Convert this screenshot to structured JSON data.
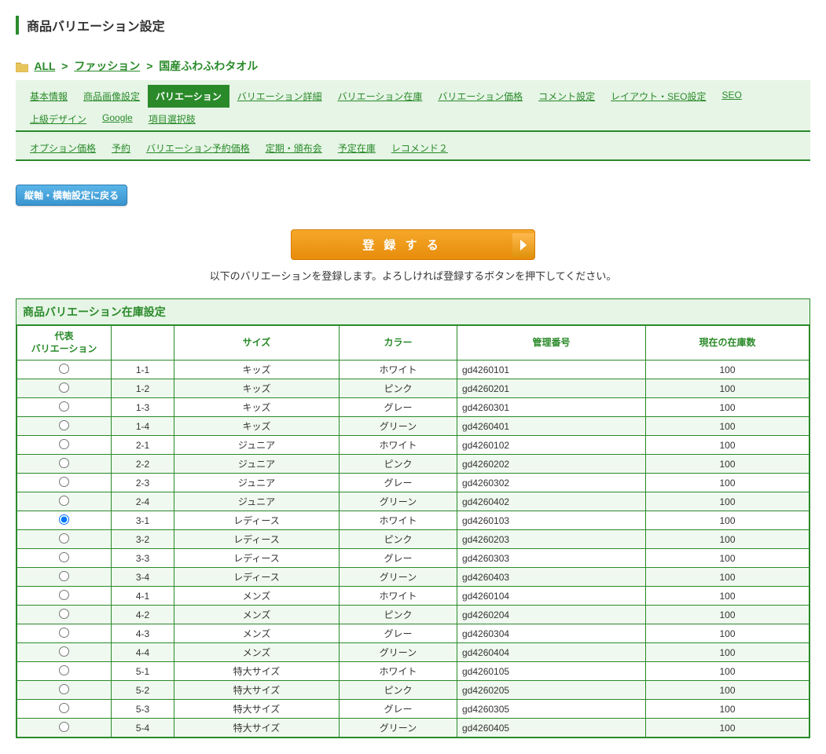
{
  "page_title": "商品バリエーション設定",
  "breadcrumb": {
    "all": "ALL",
    "category": "ファッション",
    "product": "国産ふわふわタオル"
  },
  "tabs": {
    "row1": [
      {
        "label": "基本情報",
        "active": false
      },
      {
        "label": "商品画像設定",
        "active": false
      },
      {
        "label": "バリエーション",
        "active": true
      },
      {
        "label": "バリエーション詳細",
        "active": false
      },
      {
        "label": "バリエーション在庫",
        "active": false
      },
      {
        "label": "バリエーション価格",
        "active": false
      },
      {
        "label": "コメント設定",
        "active": false
      },
      {
        "label": "レイアウト・SEO設定",
        "active": false
      },
      {
        "label": "SEO",
        "active": false
      },
      {
        "label": "上級デザイン",
        "active": false
      },
      {
        "label": "Google",
        "active": false
      },
      {
        "label": "項目選択肢",
        "active": false
      }
    ],
    "row2": [
      {
        "label": "オプション価格",
        "active": false
      },
      {
        "label": "予約",
        "active": false
      },
      {
        "label": "バリエーション予約価格",
        "active": false
      },
      {
        "label": "定期・頒布会",
        "active": false
      },
      {
        "label": "予定在庫",
        "active": false
      },
      {
        "label": "レコメンド２",
        "active": false
      }
    ]
  },
  "back_button": "縦軸・横軸設定に戻る",
  "register_button": "登 録 す る",
  "register_note": "以下のバリエーションを登録します。よろしければ登録するボタンを押下してください。",
  "panel_title": "商品バリエーション在庫設定",
  "columns": {
    "rep": "代表\nバリエーション",
    "idx": "",
    "size": "サイズ",
    "color": "カラー",
    "code": "管理番号",
    "stock": "現在の在庫数"
  },
  "rows": [
    {
      "selected": false,
      "idx": "1-1",
      "size": "キッズ",
      "color": "ホワイト",
      "code": "gd4260101",
      "stock": "100"
    },
    {
      "selected": false,
      "idx": "1-2",
      "size": "キッズ",
      "color": "ピンク",
      "code": "gd4260201",
      "stock": "100"
    },
    {
      "selected": false,
      "idx": "1-3",
      "size": "キッズ",
      "color": "グレー",
      "code": "gd4260301",
      "stock": "100"
    },
    {
      "selected": false,
      "idx": "1-4",
      "size": "キッズ",
      "color": "グリーン",
      "code": "gd4260401",
      "stock": "100"
    },
    {
      "selected": false,
      "idx": "2-1",
      "size": "ジュニア",
      "color": "ホワイト",
      "code": "gd4260102",
      "stock": "100"
    },
    {
      "selected": false,
      "idx": "2-2",
      "size": "ジュニア",
      "color": "ピンク",
      "code": "gd4260202",
      "stock": "100"
    },
    {
      "selected": false,
      "idx": "2-3",
      "size": "ジュニア",
      "color": "グレー",
      "code": "gd4260302",
      "stock": "100"
    },
    {
      "selected": false,
      "idx": "2-4",
      "size": "ジュニア",
      "color": "グリーン",
      "code": "gd4260402",
      "stock": "100"
    },
    {
      "selected": true,
      "idx": "3-1",
      "size": "レディース",
      "color": "ホワイト",
      "code": "gd4260103",
      "stock": "100"
    },
    {
      "selected": false,
      "idx": "3-2",
      "size": "レディース",
      "color": "ピンク",
      "code": "gd4260203",
      "stock": "100"
    },
    {
      "selected": false,
      "idx": "3-3",
      "size": "レディース",
      "color": "グレー",
      "code": "gd4260303",
      "stock": "100"
    },
    {
      "selected": false,
      "idx": "3-4",
      "size": "レディース",
      "color": "グリーン",
      "code": "gd4260403",
      "stock": "100"
    },
    {
      "selected": false,
      "idx": "4-1",
      "size": "メンズ",
      "color": "ホワイト",
      "code": "gd4260104",
      "stock": "100"
    },
    {
      "selected": false,
      "idx": "4-2",
      "size": "メンズ",
      "color": "ピンク",
      "code": "gd4260204",
      "stock": "100"
    },
    {
      "selected": false,
      "idx": "4-3",
      "size": "メンズ",
      "color": "グレー",
      "code": "gd4260304",
      "stock": "100"
    },
    {
      "selected": false,
      "idx": "4-4",
      "size": "メンズ",
      "color": "グリーン",
      "code": "gd4260404",
      "stock": "100"
    },
    {
      "selected": false,
      "idx": "5-1",
      "size": "特大サイズ",
      "color": "ホワイト",
      "code": "gd4260105",
      "stock": "100"
    },
    {
      "selected": false,
      "idx": "5-2",
      "size": "特大サイズ",
      "color": "ピンク",
      "code": "gd4260205",
      "stock": "100"
    },
    {
      "selected": false,
      "idx": "5-3",
      "size": "特大サイズ",
      "color": "グレー",
      "code": "gd4260305",
      "stock": "100"
    },
    {
      "selected": false,
      "idx": "5-4",
      "size": "特大サイズ",
      "color": "グリーン",
      "code": "gd4260405",
      "stock": "100"
    }
  ]
}
